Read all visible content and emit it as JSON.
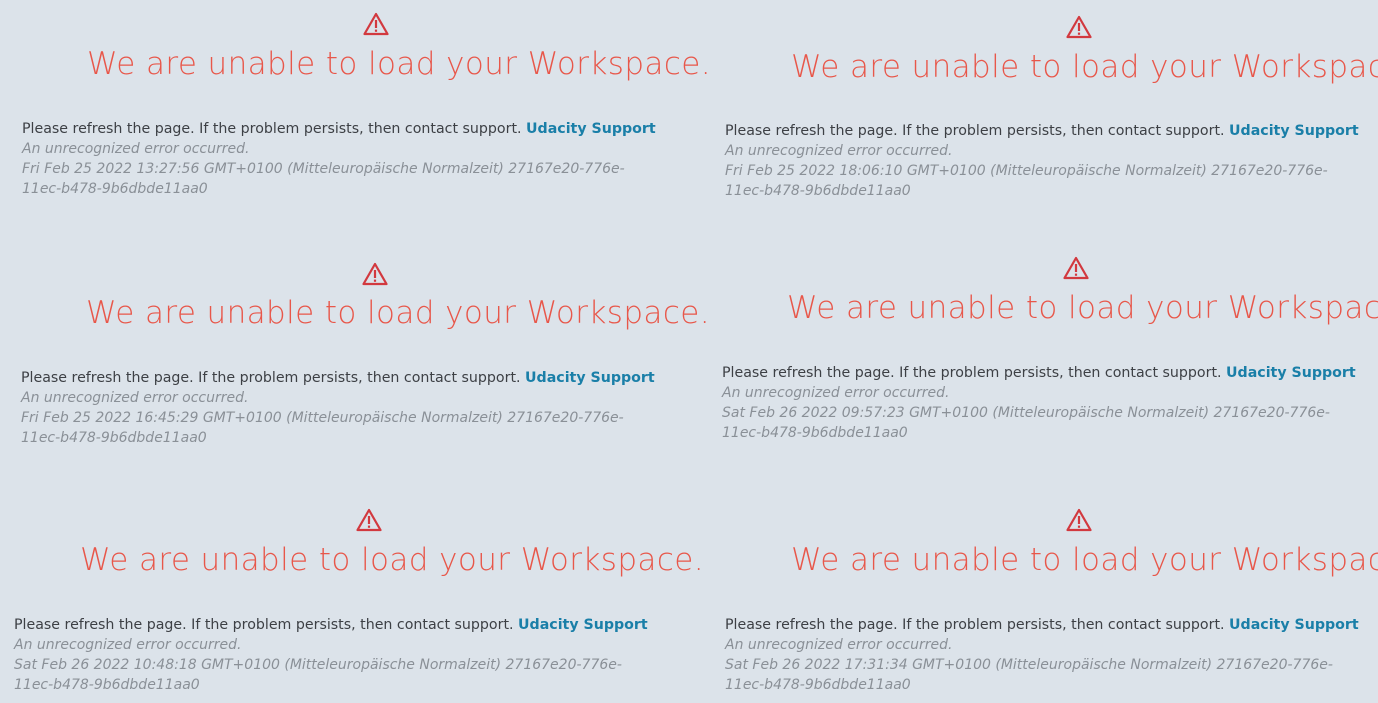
{
  "panels": [
    {
      "title": "We are unable to load your Workspace.",
      "message": "Please refresh the page. If the problem persists, then contact support.",
      "link_label": "Udacity Support",
      "error": "An unrecognized error occurred.",
      "timestamp": "Fri Feb 25 2022 13:27:56 GMT+0100 (Mitteleuropäische Normalzeit) 27167e20-776e-11ec-b478-9b6dbde11aa0"
    },
    {
      "title": "We are unable to load your Workspace.",
      "message": "Please refresh the page. If the problem persists, then contact support.",
      "link_label": "Udacity Support",
      "error": "An unrecognized error occurred.",
      "timestamp": "Fri Feb 25 2022 18:06:10 GMT+0100 (Mitteleuropäische Normalzeit) 27167e20-776e-11ec-b478-9b6dbde11aa0"
    },
    {
      "title": "We are unable to load your Workspace.",
      "message": "Please refresh the page. If the problem persists, then contact support.",
      "link_label": "Udacity Support",
      "error": "An unrecognized error occurred.",
      "timestamp": "Fri Feb 25 2022 16:45:29 GMT+0100 (Mitteleuropäische Normalzeit) 27167e20-776e-11ec-b478-9b6dbde11aa0"
    },
    {
      "title": "We are unable to load your Workspace.",
      "message": "Please refresh the page. If the problem persists, then contact support.",
      "link_label": "Udacity Support",
      "error": "An unrecognized error occurred.",
      "timestamp": "Sat Feb 26 2022 09:57:23 GMT+0100 (Mitteleuropäische Normalzeit) 27167e20-776e-11ec-b478-9b6dbde11aa0"
    },
    {
      "title": "We are unable to load your Workspace.",
      "message": "Please refresh the page. If the problem persists, then contact support.",
      "link_label": "Udacity Support",
      "error": "An unrecognized error occurred.",
      "timestamp": "Sat Feb 26 2022 10:48:18 GMT+0100 (Mitteleuropäische Normalzeit) 27167e20-776e-11ec-b478-9b6dbde11aa0"
    },
    {
      "title": "We are unable to load your Workspace.",
      "message": "Please refresh the page. If the problem persists, then contact support.",
      "link_label": "Udacity Support",
      "error": "An unrecognized error occurred.",
      "timestamp": "Sat Feb 26 2022 17:31:34 GMT+0100 (Mitteleuropäische Normalzeit) 27167e20-776e-11ec-b478-9b6dbde11aa0"
    }
  ],
  "icons": {
    "alert": "warning-triangle-icon"
  },
  "colors": {
    "title": "#e8574a",
    "link": "#1a7fa8",
    "icon": "#d2393f",
    "background": "#dce3ea"
  }
}
